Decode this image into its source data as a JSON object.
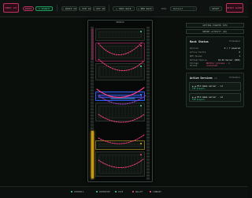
{
  "topbar": {
    "left_buttons": [
      {
        "label": "SHORT CUT",
        "icon": "scissors-icon"
      },
      {
        "label": "AUDIO"
      },
      {
        "label": "3 SEARCH"
      }
    ],
    "middle_buttons": [
      {
        "label": "+ AUDIO 2U"
      },
      {
        "label": "+ KVM 1U"
      },
      {
        "label": "+ DEV 4U"
      },
      {
        "label": "+ SERV RACK"
      },
      {
        "label": "+ NEW RACK"
      }
    ],
    "tools_label": "TOOL",
    "select_value": "Default",
    "reset_label": "RESET",
    "alert_label": "RESET ALERT"
  },
  "rack": {
    "title": "DEVRACK"
  },
  "right": {
    "buttons": [
      "GETTING STARTED TUTO",
      "REPORT ACTIVITY (1D)"
    ],
    "status": {
      "title": "Rack Status",
      "badge": "Probeable",
      "rows": [
        {
          "k": "Devices",
          "v": "6 / 7 powered"
        },
        {
          "k": "Active Faults",
          "v": "0"
        },
        {
          "k": "REP Issues",
          "v": "1"
        },
        {
          "k": "Hottest Device",
          "v": "34.62 Server (SD0)"
        },
        {
          "k": "Storage Unused",
          "v": "NetStor process · 4 connected"
        }
      ]
    },
    "services": {
      "title": "Active Services",
      "count": "(2)",
      "badge": "Probeable",
      "items": [
        {
          "name": "▲ ▲ Mid Game server · v1",
          "sub": "110 players"
        },
        {
          "name": "▲ ▲ Mid Game server · v2",
          "sub": "120 players"
        }
      ]
    }
  },
  "bottombar": {
    "items": [
      {
        "label": "CONTROLS",
        "color": "#39e39a"
      },
      {
        "label": "INVENTORY",
        "color": "#39e39a"
      },
      {
        "label": "FACE",
        "color": "#39e39a"
      },
      {
        "label": "WALLET",
        "color": "#ff5b8a"
      },
      {
        "label": "LIBRARY",
        "color": "#ff5b8a"
      }
    ]
  },
  "colors": {
    "accent_pink": "#ff3f86",
    "accent_green": "#39e39a",
    "accent_blue": "#2f5ff0",
    "accent_amber": "#e0b020"
  }
}
